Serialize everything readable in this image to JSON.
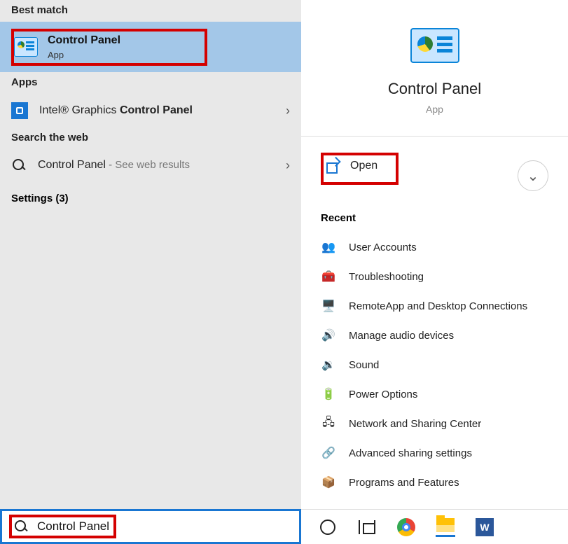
{
  "left": {
    "best_match_header": "Best match",
    "best_match": {
      "title": "Control Panel",
      "subtitle": "App"
    },
    "apps_header": "Apps",
    "apps_item_prefix": "Intel® Graphics ",
    "apps_item_bold": "Control Panel",
    "web_header": "Search the web",
    "web_item": "Control Panel",
    "web_suffix": " - See web results",
    "settings_label": "Settings (3)"
  },
  "right": {
    "hero_title": "Control Panel",
    "hero_sub": "App",
    "open_label": "Open",
    "recent_header": "Recent",
    "recent": [
      "User Accounts",
      "Troubleshooting",
      "RemoteApp and Desktop Connections",
      "Manage audio devices",
      "Sound",
      "Power Options",
      "Network and Sharing Center",
      "Advanced sharing settings",
      "Programs and Features"
    ]
  },
  "search": {
    "text": "Control Panel"
  },
  "taskbar": {
    "word_letter": "W"
  }
}
